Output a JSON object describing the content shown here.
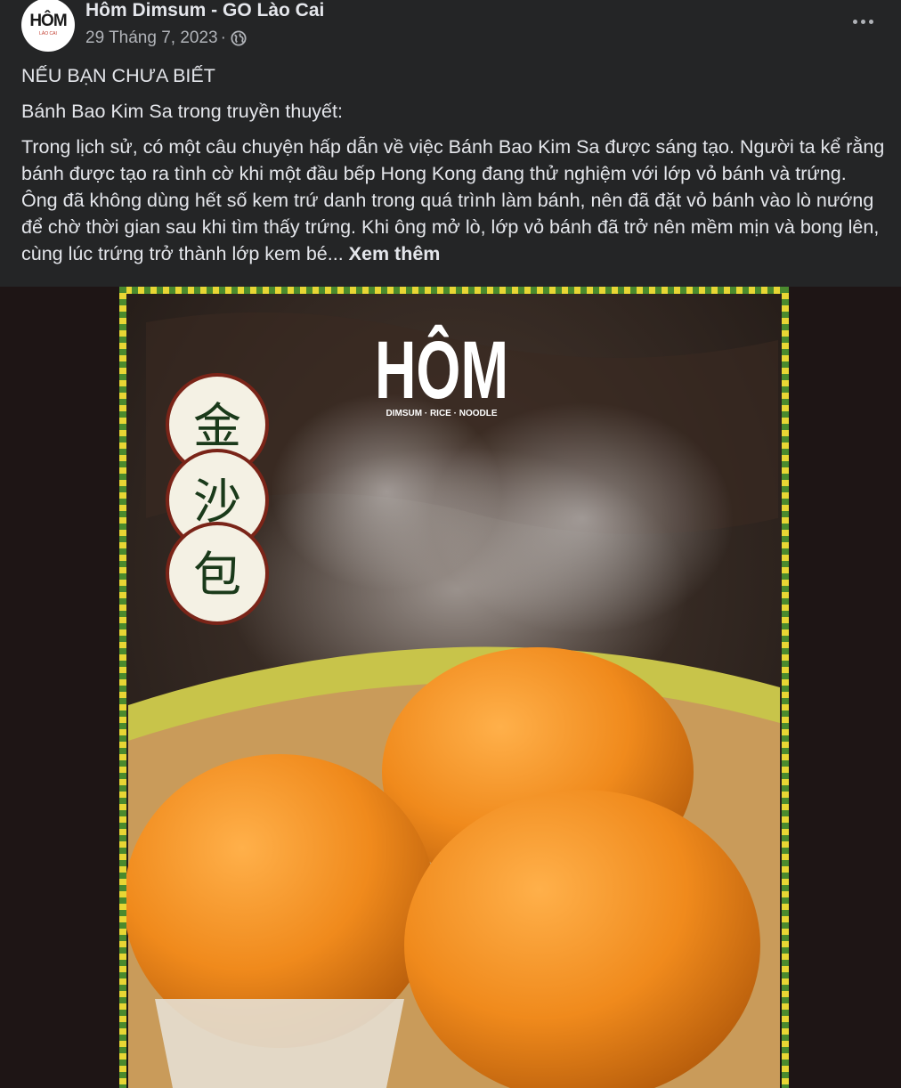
{
  "post": {
    "page_name": "Hôm Dimsum - GO Lào Cai",
    "date": "29 Tháng 7, 2023",
    "separator": "·",
    "privacy_icon": "globe-icon",
    "more_icon": "more-options-icon",
    "avatar": {
      "word": "HÔM",
      "sub": "LÀO CAI"
    },
    "heading": "NẾU BẠN CHƯA BIẾT",
    "subtitle": "Bánh Bao Kim Sa trong truyền thuyết:",
    "body": "Trong lịch sử, có một câu chuyện hấp dẫn về việc Bánh Bao Kim Sa được sáng tạo. Người ta kể rằng bánh được tạo ra tình cờ khi một đầu bếp Hong Kong đang thử nghiệm với lớp vỏ bánh và trứng. Ông đã không dùng hết số kem trứ danh trong quá trình làm bánh, nên đã đặt vỏ bánh vào lò nướng để chờ thời gian sau khi tìm thấy trứng. Khi ông mở lò, lớp vỏ bánh đã trở nên mềm mịn và bong lên, cùng lúc trứng trở thành lớp kem bé...",
    "see_more": "Xem thêm"
  },
  "photo": {
    "logo_text": "HÔM",
    "logo_tagline": "DIMSUM · RICE · NOODLE",
    "seal_chars": [
      "金",
      "沙",
      "包"
    ],
    "colors": {
      "border_green": "#4a8a2e",
      "border_yellow": "#e8d634",
      "bun_orange": "#f08a1c",
      "seal_red": "#7a2418",
      "seal_bg": "#f4f1e4"
    }
  }
}
